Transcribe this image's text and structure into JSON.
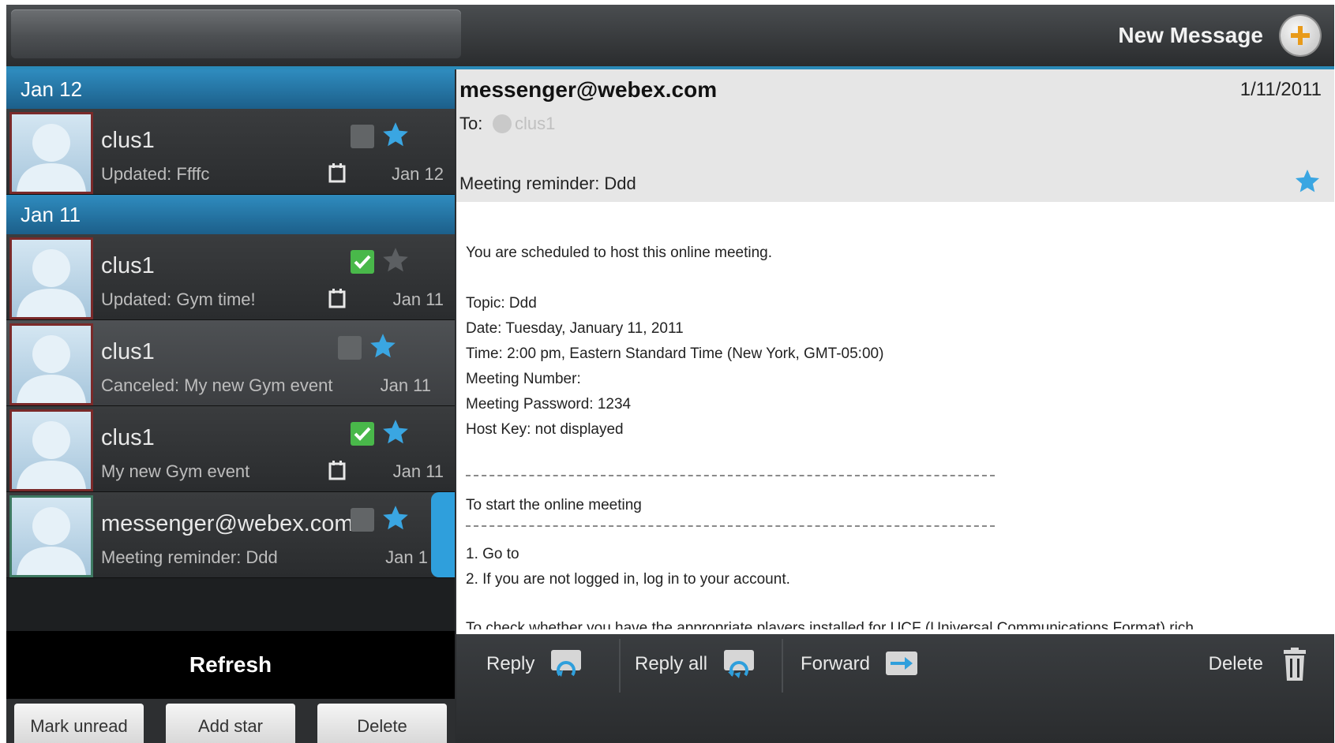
{
  "topbar": {
    "new_message_label": "New Message"
  },
  "inbox": {
    "groups": [
      {
        "date": "Jan 12",
        "items": [
          {
            "name": "clus1",
            "subtitle": "Updated: Ffffc",
            "date": "Jan 12",
            "checked": false,
            "starred": true,
            "calendar": true
          }
        ]
      },
      {
        "date": "Jan 11",
        "items": [
          {
            "name": "clus1",
            "subtitle": "Updated: Gym time!",
            "date": "Jan 11",
            "checked": true,
            "starred": false,
            "calendar": true
          },
          {
            "name": "clus1",
            "subtitle": "Canceled: My new Gym event",
            "date": "Jan 11",
            "checked": false,
            "starred": true,
            "calendar": false,
            "selected": true
          },
          {
            "name": "clus1",
            "subtitle": "My new Gym event",
            "date": "Jan 11",
            "checked": true,
            "starred": true,
            "calendar": true
          },
          {
            "name": "messenger@webex.com",
            "subtitle": "Meeting reminder: Ddd",
            "date": "Jan 1",
            "checked": false,
            "starred": true,
            "calendar": false
          }
        ]
      }
    ],
    "refresh_label": "Refresh",
    "actions": {
      "mark_unread": "Mark unread",
      "add_star": "Add star",
      "delete": "Delete"
    }
  },
  "message": {
    "from": "messenger@webex.com",
    "date": "1/11/2011",
    "to_label": "To:",
    "recipient": "clus1",
    "subject": "Meeting reminder: Ddd",
    "body": {
      "intro": "You are scheduled to host this online meeting.",
      "topic": "Topic: Ddd",
      "date": "Date: Tuesday, January 11, 2011",
      "time": "Time: 2:00 pm, Eastern Standard Time (New York, GMT-05:00)",
      "meeting_number": "Meeting Number:",
      "meeting_password": "Meeting Password: 1234",
      "host_key": "Host Key: not displayed",
      "start_heading": "To start the online meeting",
      "step1": "1. Go to",
      "step2": "2. If you are not logged in, log in to your account.",
      "check_players": "To check whether you have the appropriate players installed for UCF (Universal Communications Format) rich"
    },
    "actions": {
      "reply": "Reply",
      "reply_all": "Reply all",
      "forward": "Forward",
      "delete": "Delete"
    }
  },
  "colors": {
    "accent_blue": "#2f8cbf",
    "check_green": "#49b84a",
    "star_blue": "#3aa6e2"
  }
}
